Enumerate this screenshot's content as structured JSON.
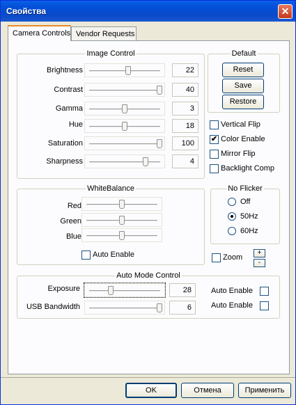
{
  "window": {
    "title": "Свойства",
    "close_glyph": "✕"
  },
  "tabs": [
    {
      "label": "Camera Controls",
      "active": true
    },
    {
      "label": "Vendor Requests",
      "active": false
    }
  ],
  "image_control": {
    "title": "Image Control",
    "rows": [
      {
        "label": "Brightness",
        "value": "22",
        "level": 0.55
      },
      {
        "label": "Contrast",
        "value": "40",
        "level": 1.0
      },
      {
        "label": "Gamma",
        "value": "3",
        "level": 0.5
      },
      {
        "label": "Hue",
        "value": "18",
        "level": 0.5
      },
      {
        "label": "Saturation",
        "value": "100",
        "level": 1.0
      },
      {
        "label": "Sharpness",
        "value": "4",
        "level": 0.8
      }
    ]
  },
  "default_group": {
    "title": "Default",
    "reset_label": "Reset",
    "save_label": "Save",
    "restore_label": "Restore"
  },
  "options": [
    {
      "label": "Vertical Flip",
      "checked": false
    },
    {
      "label": "Color Enable",
      "checked": true
    },
    {
      "label": "Mirror Flip",
      "checked": false
    },
    {
      "label": "Backlight Comp",
      "checked": false
    }
  ],
  "white_balance": {
    "title": "WhiteBalance",
    "rows": [
      {
        "label": "Red",
        "level": 0.5
      },
      {
        "label": "Green",
        "level": 0.5
      },
      {
        "label": "Blue",
        "level": 0.5
      }
    ],
    "auto_enable_label": "Auto Enable",
    "auto_enable_checked": false
  },
  "no_flicker": {
    "title": "No Flicker",
    "options": [
      {
        "label": "Off",
        "selected": false
      },
      {
        "label": "50Hz",
        "selected": true
      },
      {
        "label": "60Hz",
        "selected": false
      }
    ]
  },
  "zoom": {
    "label": "Zoom",
    "checked": false,
    "plus": "+",
    "minus": "-"
  },
  "auto_mode": {
    "title": "Auto Mode Control",
    "rows": [
      {
        "label": "Exposure",
        "value": "28",
        "level": 0.3,
        "auto_label": "Auto Enable",
        "auto_checked": false
      },
      {
        "label": "USB Bandwidth",
        "value": "6",
        "level": 1.0,
        "auto_label": "Auto Enable",
        "auto_checked": false
      }
    ]
  },
  "buttons": {
    "ok": "OK",
    "cancel": "Отмена",
    "apply": "Применить"
  },
  "check_glyph": "✔"
}
